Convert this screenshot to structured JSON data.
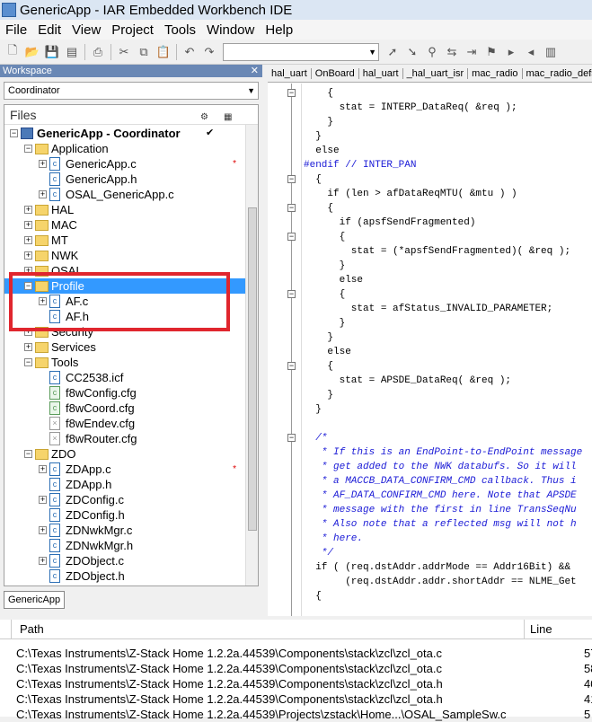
{
  "title": "GenericApp - IAR Embedded Workbench IDE",
  "menu": [
    "File",
    "Edit",
    "View",
    "Project",
    "Tools",
    "Window",
    "Help"
  ],
  "workspace": {
    "header": "Workspace",
    "config": "Coordinator",
    "files_label": "Files",
    "tab": "GenericApp",
    "tree": [
      {
        "label": "GenericApp - Coordinator",
        "level": 0,
        "kind": "project",
        "exp": "-",
        "bold": true,
        "check": "✔"
      },
      {
        "label": "Application",
        "level": 1,
        "kind": "folder",
        "exp": "-"
      },
      {
        "label": "GenericApp.c",
        "level": 2,
        "kind": "file",
        "exp": "+",
        "star": "*"
      },
      {
        "label": "GenericApp.h",
        "level": 2,
        "kind": "file",
        "exp": ""
      },
      {
        "label": "OSAL_GenericApp.c",
        "level": 2,
        "kind": "file",
        "exp": "+"
      },
      {
        "label": "HAL",
        "level": 1,
        "kind": "folder",
        "exp": "+"
      },
      {
        "label": "MAC",
        "level": 1,
        "kind": "folder",
        "exp": "+"
      },
      {
        "label": "MT",
        "level": 1,
        "kind": "folder",
        "exp": "+"
      },
      {
        "label": "NWK",
        "level": 1,
        "kind": "folder",
        "exp": "+"
      },
      {
        "label": "OSAL",
        "level": 1,
        "kind": "folder",
        "exp": "+"
      },
      {
        "label": "Profile",
        "level": 1,
        "kind": "folder",
        "exp": "-",
        "selected": true
      },
      {
        "label": "AF.c",
        "level": 2,
        "kind": "file",
        "exp": "+"
      },
      {
        "label": "AF.h",
        "level": 2,
        "kind": "file",
        "exp": ""
      },
      {
        "label": "Security",
        "level": 1,
        "kind": "folder",
        "exp": "+"
      },
      {
        "label": "Services",
        "level": 1,
        "kind": "folder",
        "exp": "+"
      },
      {
        "label": "Tools",
        "level": 1,
        "kind": "folder",
        "exp": "-"
      },
      {
        "label": "CC2538.icf",
        "level": 2,
        "kind": "file",
        "exp": ""
      },
      {
        "label": "f8wConfig.cfg",
        "level": 2,
        "kind": "cfg",
        "exp": ""
      },
      {
        "label": "f8wCoord.cfg",
        "level": 2,
        "kind": "cfg",
        "exp": ""
      },
      {
        "label": "f8wEndev.cfg",
        "level": 2,
        "kind": "grey",
        "exp": ""
      },
      {
        "label": "f8wRouter.cfg",
        "level": 2,
        "kind": "grey",
        "exp": ""
      },
      {
        "label": "ZDO",
        "level": 1,
        "kind": "folder",
        "exp": "-"
      },
      {
        "label": "ZDApp.c",
        "level": 2,
        "kind": "file",
        "exp": "+",
        "star": "*"
      },
      {
        "label": "ZDApp.h",
        "level": 2,
        "kind": "file",
        "exp": ""
      },
      {
        "label": "ZDConfig.c",
        "level": 2,
        "kind": "file",
        "exp": "+"
      },
      {
        "label": "ZDConfig.h",
        "level": 2,
        "kind": "file",
        "exp": ""
      },
      {
        "label": "ZDNwkMgr.c",
        "level": 2,
        "kind": "file",
        "exp": "+"
      },
      {
        "label": "ZDNwkMgr.h",
        "level": 2,
        "kind": "file",
        "exp": ""
      },
      {
        "label": "ZDObject.c",
        "level": 2,
        "kind": "file",
        "exp": "+"
      },
      {
        "label": "ZDObject.h",
        "level": 2,
        "kind": "file",
        "exp": ""
      }
    ]
  },
  "editor": {
    "tabs": [
      "hal_uart",
      "OnBoard",
      "hal_uart",
      "_hal_uart_isr",
      "mac_radio",
      "mac_radio_defs"
    ],
    "lines": [
      {
        "t": "    {",
        "c": ""
      },
      {
        "t": "      stat = INTERP_DataReq( &req );",
        "c": ""
      },
      {
        "t": "    }",
        "c": ""
      },
      {
        "t": "  }",
        "c": ""
      },
      {
        "t": "  else",
        "c": ""
      },
      {
        "t": "#endif // INTER_PAN",
        "c": "pp"
      },
      {
        "t": "  {",
        "c": ""
      },
      {
        "t": "    if (len > afDataReqMTU( &mtu ) )",
        "c": ""
      },
      {
        "t": "    {",
        "c": ""
      },
      {
        "t": "      if (apsfSendFragmented)",
        "c": ""
      },
      {
        "t": "      {",
        "c": ""
      },
      {
        "t": "        stat = (*apsfSendFragmented)( &req );",
        "c": ""
      },
      {
        "t": "      }",
        "c": ""
      },
      {
        "t": "      else",
        "c": ""
      },
      {
        "t": "      {",
        "c": ""
      },
      {
        "t": "        stat = afStatus_INVALID_PARAMETER;",
        "c": ""
      },
      {
        "t": "      }",
        "c": ""
      },
      {
        "t": "    }",
        "c": ""
      },
      {
        "t": "    else",
        "c": ""
      },
      {
        "t": "    {",
        "c": ""
      },
      {
        "t": "      stat = APSDE_DataReq( &req );",
        "c": ""
      },
      {
        "t": "    }",
        "c": ""
      },
      {
        "t": "  }",
        "c": ""
      },
      {
        "t": "",
        "c": ""
      },
      {
        "t": "  /*",
        "c": "cm"
      },
      {
        "t": "   * If this is an EndPoint-to-EndPoint message",
        "c": "cm"
      },
      {
        "t": "   * get added to the NWK databufs. So it will",
        "c": "cm"
      },
      {
        "t": "   * a MACCB_DATA_CONFIRM_CMD callback. Thus i",
        "c": "cm"
      },
      {
        "t": "   * AF_DATA_CONFIRM_CMD here. Note that APSDE",
        "c": "cm"
      },
      {
        "t": "   * message with the first in line TransSeqNu",
        "c": "cm"
      },
      {
        "t": "   * Also note that a reflected msg will not h",
        "c": "cm"
      },
      {
        "t": "   * here.",
        "c": "cm"
      },
      {
        "t": "   */",
        "c": "cm"
      },
      {
        "t": "  if ( (req.dstAddr.addrMode == Addr16Bit) &&",
        "c": ""
      },
      {
        "t": "       (req.dstAddr.addr.shortAddr == NLME_Get",
        "c": ""
      },
      {
        "t": "  {",
        "c": ""
      }
    ]
  },
  "results": {
    "col_path": "Path",
    "col_line": "Line",
    "rows": [
      {
        "path": "C:\\Texas Instruments\\Z-Stack Home 1.2.2a.44539\\Components\\stack\\zcl\\zcl_ota.c",
        "line": "57"
      },
      {
        "path": "C:\\Texas Instruments\\Z-Stack Home 1.2.2a.44539\\Components\\stack\\zcl\\zcl_ota.c",
        "line": "58"
      },
      {
        "path": "C:\\Texas Instruments\\Z-Stack Home 1.2.2a.44539\\Components\\stack\\zcl\\zcl_ota.h",
        "line": "40"
      },
      {
        "path": "C:\\Texas Instruments\\Z-Stack Home 1.2.2a.44539\\Components\\stack\\zcl\\zcl_ota.h",
        "line": "41"
      },
      {
        "path": "C:\\Texas Instruments\\Z-Stack Home 1.2.2a.44539\\Projects\\zstack\\Home...\\OSAL_SampleSw.c",
        "line": "5"
      }
    ]
  }
}
